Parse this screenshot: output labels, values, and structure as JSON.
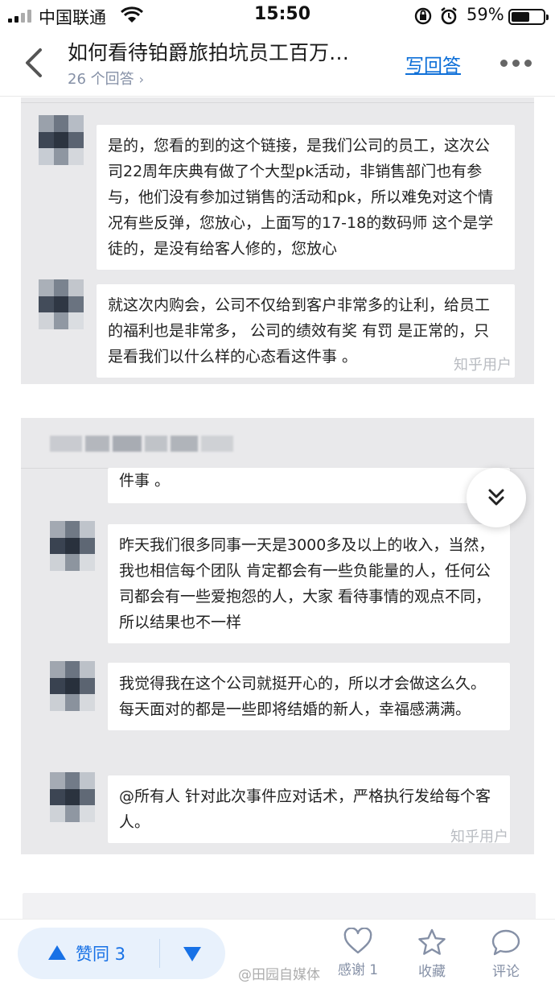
{
  "status_bar": {
    "carrier": "中国联通",
    "time": "15:50",
    "battery_pct": "59%",
    "battery_level": 0.59,
    "icons": [
      "signal-icon",
      "wifi-icon",
      "orientation-lock-icon",
      "alarm-icon",
      "battery-icon"
    ]
  },
  "nav": {
    "title": "如何看待铂爵旅拍坑员工百万…",
    "answer_count": "26 个回答",
    "write_answer": "写回答",
    "icons": [
      "back-chevron-icon",
      "chevron-right-icon",
      "more-icon"
    ]
  },
  "chat1": {
    "messages": [
      "是的，您看的到的这个链接，是我们公司的员工，这次公司22周年庆典有做了个大型pk活动，非销售部门也有参与，他们没有参加过销售的活动和pk，所以难免对这个情况有些反弹，您放心，上面写的17-18的数码师 这个是学徒的，是没有给客人修的，您放心",
      "就这次内购会，公司不仅给到客户非常多的让利，给员工的福利也是非常多， 公司的绩效有奖 有罚 是正常的，只是看我们以什么样的心态看这件事 。"
    ],
    "watermark": "知乎用户"
  },
  "chat2": {
    "partial_text": "件事 。",
    "messages": [
      "昨天我们很多同事一天是3000多及以上的收入，当然，我也相信每个团队 肯定都会有一些负能量的人，任何公司都会有一些爱抱怨的人，大家 看待事情的观点不同，所以结果也不一样",
      "我觉得我在这个公司就挺开心的，所以才会做这么久。每天面对的都是一些即将结婚的新人，幸福感满满。",
      "@所有人  针对此次事件应对话术，严格执行发给每个客人。"
    ],
    "watermark": "知乎用户"
  },
  "bottom_bar": {
    "vote_up": "赞同 3",
    "thanks": "感谢 1",
    "favorite": "收藏",
    "comment": "评论",
    "weibo_watermark": "@田园自媒体",
    "icons": [
      "upvote-triangle-icon",
      "downvote-triangle-icon",
      "heart-icon",
      "star-icon",
      "comment-bubble-icon"
    ]
  },
  "colors": {
    "link_blue": "#0d6fd8",
    "vote_blue": "#1771e6",
    "vote_bg": "#e8f1fc",
    "card_gray": "#e9e9eb",
    "meta_gray": "#8590a6"
  }
}
